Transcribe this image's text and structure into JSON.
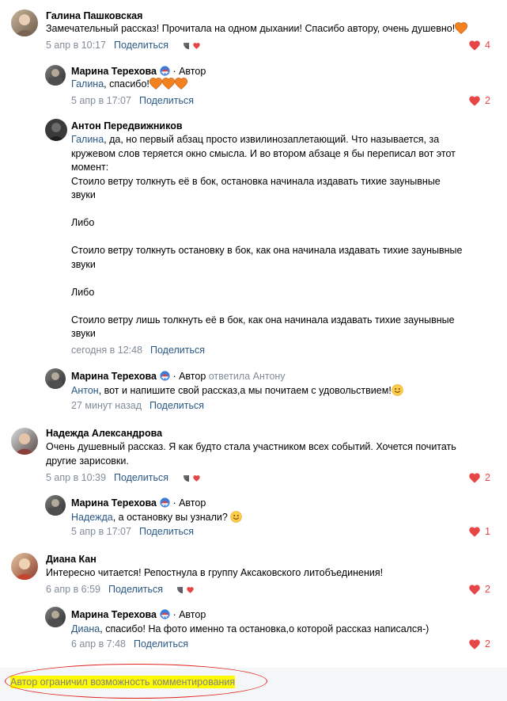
{
  "comments": [
    {
      "author": "Галина Пашковская",
      "text": "Замечательный рассказ! Прочитала на одном дыхании! Спасибо автору, очень душевно!",
      "time": "5 апр в 10:17",
      "share": "Поделиться",
      "likes": "4"
    },
    {
      "author": "Марина Терехова",
      "author_label": "· Автор",
      "addressee": "Галина",
      "text": ", спасибо!",
      "time": "5 апр в 17:07",
      "share": "Поделиться",
      "likes": "2"
    },
    {
      "author": "Антон Передвижников",
      "addressee": "Галина",
      "text_line1": ", да, но первый абзац просто извилинозаплетающий. Что называется, за",
      "text_line2": "кружевом слов теряется окно смысла. И во втором абзаце я бы переписал вот этот",
      "text_line3": "момент:",
      "text_line4": "Стоило ветру толкнуть её в бок, остановка начинала издавать тихие заунывные",
      "text_line5": "звуки",
      "text_line6": "Либо",
      "text_line7": "Стоило ветру толкнуть остановку в бок, как она начинала издавать тихие заунывные",
      "text_line8": "звуки",
      "text_line9": "Либо",
      "text_line10": "Стоило ветру лишь толкнуть её в бок, как она начинала издавать тихие заунывные",
      "text_line11": "звуки",
      "time": "сегодня в 12:48",
      "share": "Поделиться"
    },
    {
      "author": "Марина Терехова",
      "author_label": "· Автор",
      "reply_to": "ответила Антону",
      "addressee": "Антон",
      "text": ", вот и напишите свой рассказ,а мы почитаем с удовольствием!",
      "time": "27 минут назад",
      "share": "Поделиться"
    },
    {
      "author": "Надежда Александрова",
      "text_line1": "Очень душевный рассказ. Я как будто стала участником всех событий. Хочется почитать",
      "text_line2": "другие зарисовки.",
      "time": "5 апр в 10:39",
      "share": "Поделиться",
      "likes": "2"
    },
    {
      "author": "Марина Терехова",
      "author_label": "· Автор",
      "addressee": "Надежда",
      "text": ", а остановку вы узнали?",
      "time": "5 апр в 17:07",
      "share": "Поделиться",
      "likes": "1"
    },
    {
      "author": "Диана Кан",
      "text": "Интересно читается! Репостнула в группу Аксаковского литобъединения!",
      "time": "6 апр в 6:59",
      "share": "Поделиться",
      "likes": "2"
    },
    {
      "author": "Марина Терехова",
      "author_label": "· Автор",
      "addressee": "Диана",
      "text": ", спасибо! На фото именно та остановка,о которой рассказ написался-)",
      "time": "6 апр в 7:48",
      "share": "Поделиться",
      "likes": "2"
    }
  ],
  "footer": {
    "notice": "Автор ограничил возможность комментирования"
  },
  "colors": {
    "link": "#2a5885",
    "meta": "#818c99",
    "like": "#e64646",
    "highlight": "#fffb00",
    "annotation": "#e0221b"
  }
}
